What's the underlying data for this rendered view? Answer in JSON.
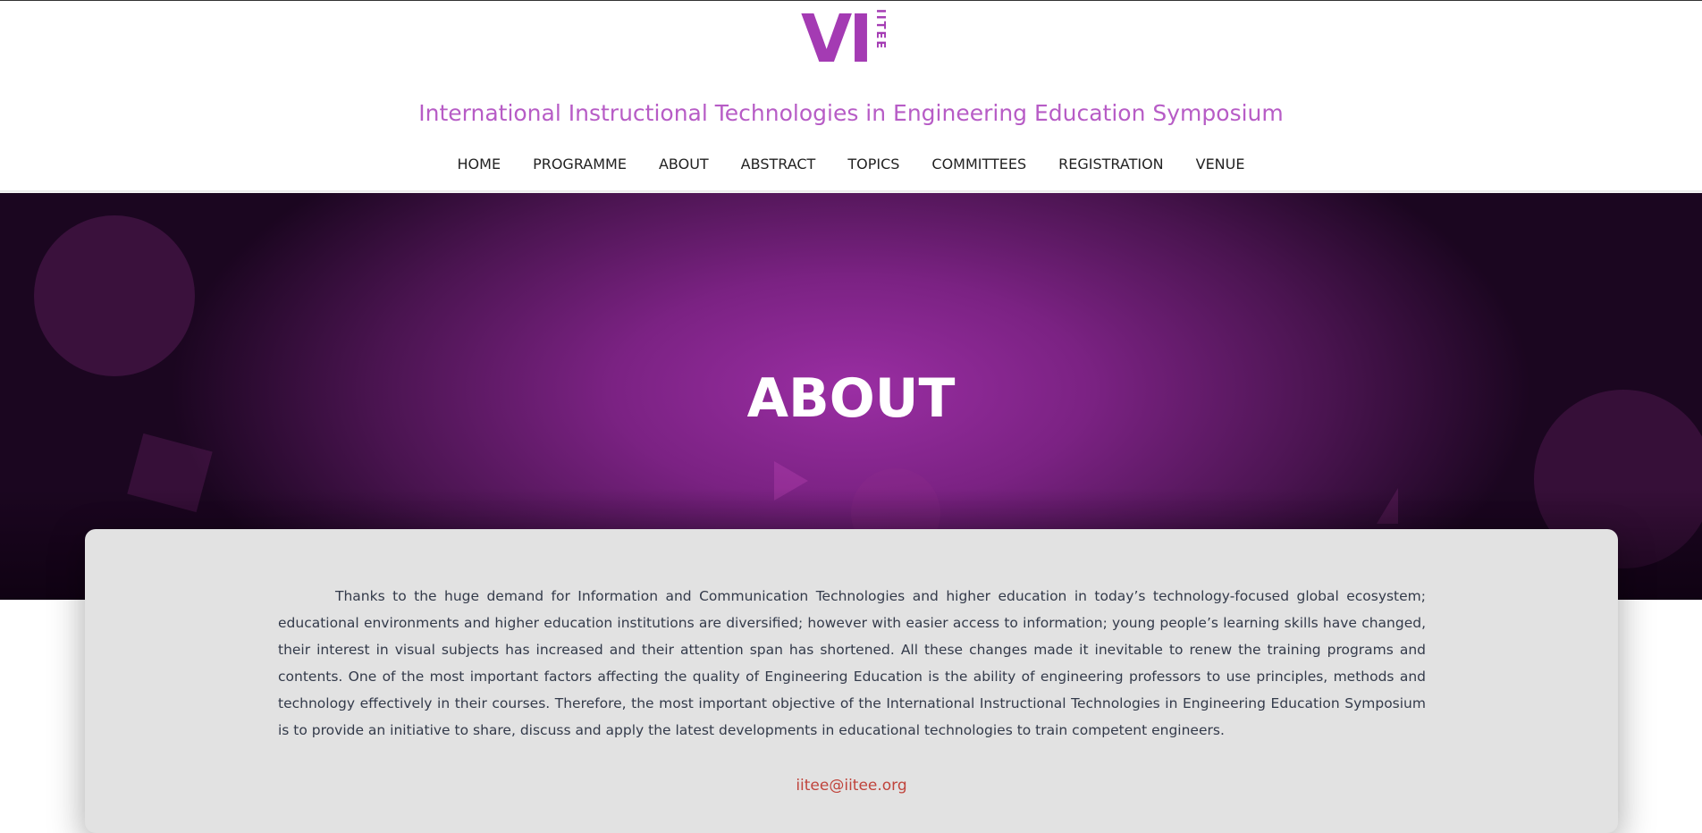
{
  "header": {
    "logo_main": "VI",
    "logo_side": "IITEE",
    "site_title": "International Instructional Technologies in Engineering Education Symposium"
  },
  "nav": {
    "items": [
      "HOME",
      "PROGRAMME",
      "ABOUT",
      "ABSTRACT",
      "TOPICS",
      "COMMITTEES",
      "REGISTRATION",
      "VENUE"
    ]
  },
  "hero": {
    "title": "ABOUT"
  },
  "content": {
    "paragraph": "Thanks to the huge demand for Information and Communication Technologies and higher education in today’s technology-focused global ecosystem; educational environments and higher education institutions are diversified; however with easier access to information; young people’s learning skills have changed, their interest in visual subjects has increased and their attention span has shortened. All these changes made it inevitable to renew the training programs and contents. One of the most important factors affecting the quality of Engineering Education is the ability of engineering professors to use principles, methods and technology effectively in their courses. Therefore, the most important objective of the International Instructional Technologies in Engineering Education Symposium is to provide an initiative to share, discuss and apply the latest developments in educational technologies to train competent engineers.",
    "email": "iitee@iitee.org"
  },
  "colors": {
    "brand": "#a43bb3",
    "title": "#b75cc6",
    "link": "#c0443c"
  }
}
